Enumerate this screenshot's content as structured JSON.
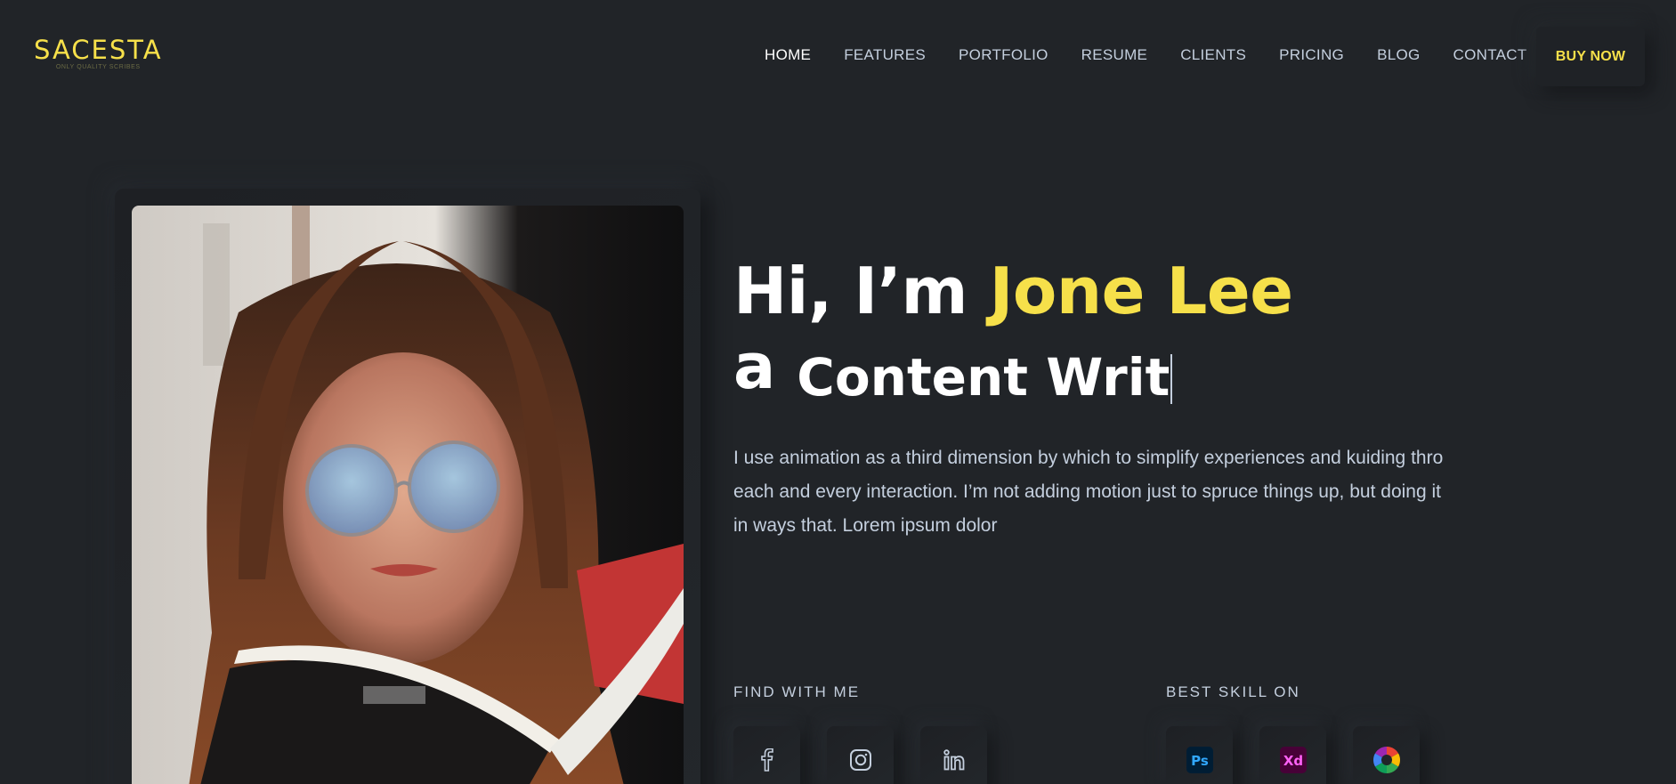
{
  "brand": {
    "logo": "SACESTA",
    "tagline": "ONLY QUALITY SCRIBES"
  },
  "nav": {
    "items": [
      "HOME",
      "FEATURES",
      "PORTFOLIO",
      "RESUME",
      "CLIENTS",
      "PRICING",
      "BLOG",
      "CONTACT"
    ],
    "active": "HOME",
    "cta": "BUY NOW"
  },
  "hero": {
    "greeting": "Hi, I’m ",
    "name": "Jone Lee",
    "article": "a",
    "role": "Content Writ",
    "description": "I use animation as a third dimension by which to simplify experiences and kuiding thro each and every interaction. I’m not adding motion just to spruce things up, but doing it in ways that. Lorem ipsum dolor"
  },
  "find_with_me": {
    "title": "FIND WITH ME",
    "icons": [
      "facebook-icon",
      "instagram-icon",
      "linkedin-icon"
    ]
  },
  "best_skill_on": {
    "title": "BEST SKILL ON",
    "icons": [
      "photoshop-icon",
      "adobe-xd-icon",
      "picasa-icon"
    ],
    "labels": {
      "ps": "Ps",
      "xd": "Xd"
    }
  },
  "colors": {
    "background": "#212428",
    "accent": "#f6e04a",
    "text": "#c4cfde"
  }
}
